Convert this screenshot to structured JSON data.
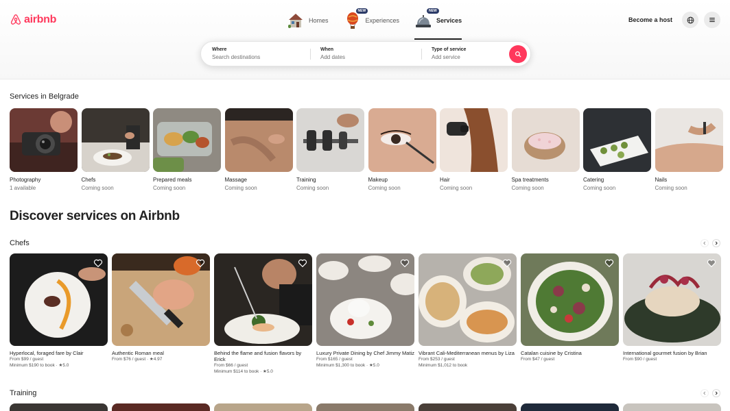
{
  "header": {
    "logo_text": "airbnb",
    "nav": [
      {
        "label": "Homes",
        "icon": "house-icon",
        "badge": ""
      },
      {
        "label": "Experiences",
        "icon": "hot-air-balloon-icon",
        "badge": "NEW"
      },
      {
        "label": "Services",
        "icon": "service-bell-icon",
        "badge": "NEW",
        "active": true
      }
    ],
    "become_host": "Become a host",
    "globe_icon": "globe-icon",
    "menu_icon": "hamburger-menu-icon"
  },
  "search": {
    "where_label": "Where",
    "where_placeholder": "Search destinations",
    "when_label": "When",
    "when_placeholder": "Add dates",
    "type_label": "Type of service",
    "type_placeholder": "Add service",
    "button_icon": "search-icon",
    "accent_color": "#ff385c"
  },
  "services_section": {
    "title": "Services in Belgrade",
    "items": [
      {
        "name": "Photography",
        "sub": "1 available"
      },
      {
        "name": "Chefs",
        "sub": "Coming soon"
      },
      {
        "name": "Prepared meals",
        "sub": "Coming soon"
      },
      {
        "name": "Massage",
        "sub": "Coming soon"
      },
      {
        "name": "Training",
        "sub": "Coming soon"
      },
      {
        "name": "Makeup",
        "sub": "Coming soon"
      },
      {
        "name": "Hair",
        "sub": "Coming soon"
      },
      {
        "name": "Spa treatments",
        "sub": "Coming soon"
      },
      {
        "name": "Catering",
        "sub": "Coming soon"
      },
      {
        "name": "Nails",
        "sub": "Coming soon"
      }
    ]
  },
  "discover_title": "Discover services on Airbnb",
  "chefs_section": {
    "title": "Chefs",
    "items": [
      {
        "title": "Hyperlocal, foraged fare by Clair",
        "line1": "From $99 / guest",
        "line2": "Minimum $190 to book · ★5.0"
      },
      {
        "title": "Authentic Roman meal",
        "line1": "From $76 / guest · ★4.97",
        "line2": ""
      },
      {
        "title": "Behind the flame and fusion flavors by Erick",
        "line1": "From $66 / guest",
        "line2": "Minimum $114 to book · ★5.0"
      },
      {
        "title": "Luxury Private Dining by Chef Jimmy Matiz",
        "line1": "From $165 / guest",
        "line2": "Minimum $1,300 to book · ★5.0"
      },
      {
        "title": "Vibrant Cali-Mediterranean menus by Liza",
        "line1": "From $253 / guest",
        "line2": "Minimum $1,012 to book"
      },
      {
        "title": "Catalan cuisine by Cristina",
        "line1": "From $47 / guest",
        "line2": ""
      },
      {
        "title": "International gourmet fusion by Brian",
        "line1": "From $90 / guest",
        "line2": ""
      }
    ]
  },
  "training_section": {
    "title": "Training"
  }
}
